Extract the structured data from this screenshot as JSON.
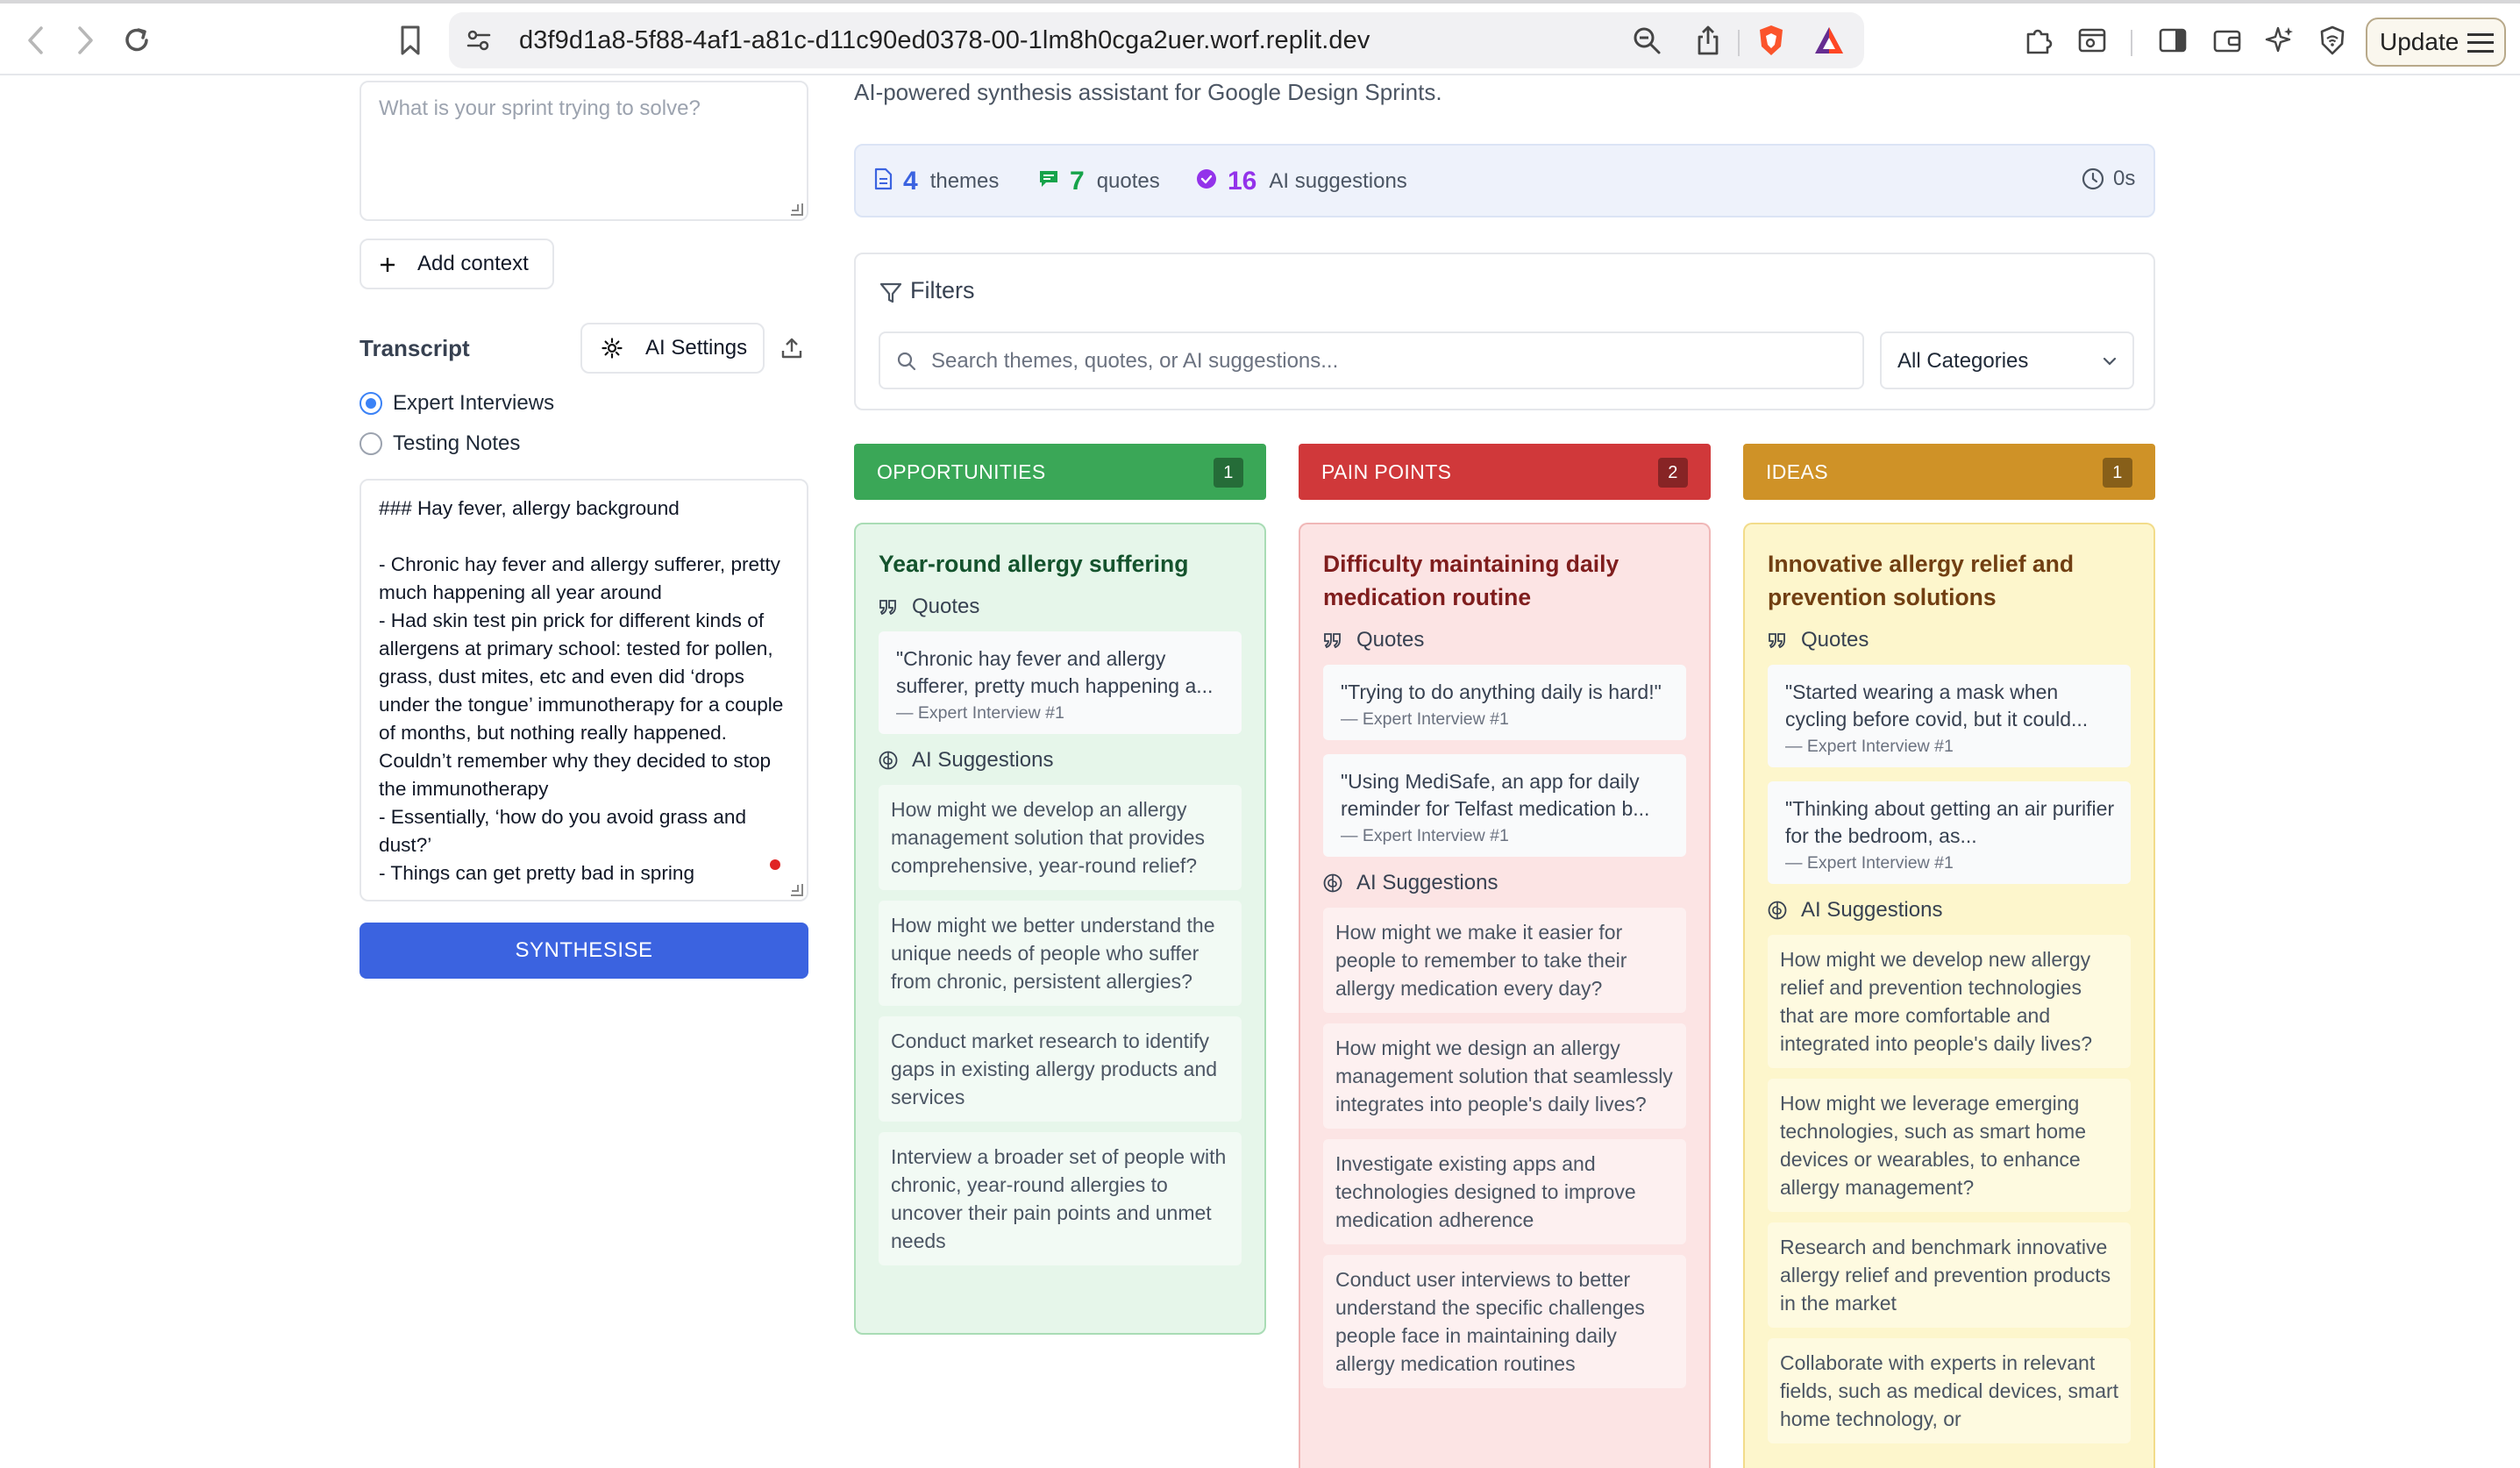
{
  "browser": {
    "url": "d3f9d1a8-5f88-4af1-a81c-d11c90ed0378-00-1lm8h0cga2uer.worf.replit.dev",
    "update_label": "Update"
  },
  "left": {
    "problem_placeholder": "What is your sprint trying to solve?",
    "add_context_label": "Add context",
    "transcript_title": "Transcript",
    "ai_settings_label": "AI Settings",
    "radio_options": [
      "Expert Interviews",
      "Testing Notes"
    ],
    "radio_selected": "Expert Interviews",
    "transcript_text": "### Hay fever, allergy background\n\n- Chronic hay fever and allergy sufferer, pretty much happening all year around\n- Had skin test pin prick for different kinds of allergens at primary school: tested for pollen, grass, dust mites, etc and even did ‘drops under the tongue’ immunotherapy for a couple of months, but nothing really happened. Couldn’t remember why they decided to stop the immunotherapy\n- Essentially, ‘how do you avoid grass and dust?’\n- Things can get pretty bad in spring",
    "synthesise_label": "SYNTHESISE"
  },
  "main": {
    "subtitle": "AI-powered synthesis assistant for Google Design Sprints.",
    "stats": {
      "themes_count": "4",
      "themes_label": "themes",
      "quotes_count": "7",
      "quotes_label": "quotes",
      "ai_count": "16",
      "ai_label": "AI suggestions",
      "timer": "0s",
      "colors": {
        "themes": "#3b63e0",
        "quotes": "#16a34a",
        "ai": "#9333ea"
      }
    },
    "filters": {
      "title": "Filters",
      "search_placeholder": "Search themes, quotes, or AI suggestions...",
      "category_value": "All Categories"
    },
    "quotes_heading": "Quotes",
    "ai_heading": "AI Suggestions",
    "columns": [
      {
        "header": "OPPORTUNITIES",
        "count": "1",
        "header_color": "#3aa757",
        "card_bg": "#e6f6ea",
        "card_border": "#a9dcb5",
        "title_color": "#14532d",
        "item_bg": "#f2faf4",
        "title": "Year-round allergy suffering",
        "quotes": [
          {
            "text": "\"Chronic hay fever and allergy sufferer, pretty much happening a...",
            "source": "— Expert Interview #1"
          }
        ],
        "suggestions": [
          "How might we develop an allergy management solution that provides comprehensive, year-round relief?",
          "How might we better understand the unique needs of people who suffer from chronic, persistent allergies?",
          "Conduct market research to identify gaps in existing allergy products and services",
          "Interview a broader set of people with chronic, year-round allergies to uncover their pain points and unmet needs"
        ]
      },
      {
        "header": "PAIN POINTS",
        "count": "2",
        "header_color": "#d0383a",
        "card_bg": "#fce4e4",
        "card_border": "#f0b7b7",
        "title_color": "#7f1d1d",
        "item_bg": "#fdf0f0",
        "title": "Difficulty maintaining daily medication routine",
        "quotes": [
          {
            "text": "\"Trying to do anything daily is hard!\"",
            "source": "— Expert Interview #1"
          },
          {
            "text": "\"Using MediSafe, an app for daily reminder for Telfast medication b...",
            "source": "— Expert Interview #1"
          }
        ],
        "suggestions": [
          "How might we make it easier for people to remember to take their allergy medication every day?",
          "How might we design an allergy management solution that seamlessly integrates into people's daily lives?",
          "Investigate existing apps and technologies designed to improve medication adherence",
          "Conduct user interviews to better understand the specific challenges people face in maintaining daily allergy medication routines"
        ]
      },
      {
        "header": "IDEAS",
        "count": "1",
        "header_color": "#cf9227",
        "card_bg": "#fdf6cc",
        "card_border": "#f2dc8a",
        "title_color": "#713f12",
        "item_bg": "#fefae0",
        "title": "Innovative allergy relief and prevention solutions",
        "quotes": [
          {
            "text": "\"Started wearing a mask when cycling before covid, but it could...",
            "source": "— Expert Interview #1"
          },
          {
            "text": "\"Thinking about getting an air purifier for the bedroom, as...",
            "source": "— Expert Interview #1"
          }
        ],
        "suggestions": [
          "How might we develop new allergy relief and prevention technologies that are more comfortable and integrated into people's daily lives?",
          "How might we leverage emerging technologies, such as smart home devices or wearables, to enhance allergy management?",
          "Research and benchmark innovative allergy relief and prevention products in the market",
          "Collaborate with experts in relevant fields, such as medical devices, smart home technology, or"
        ]
      }
    ]
  }
}
